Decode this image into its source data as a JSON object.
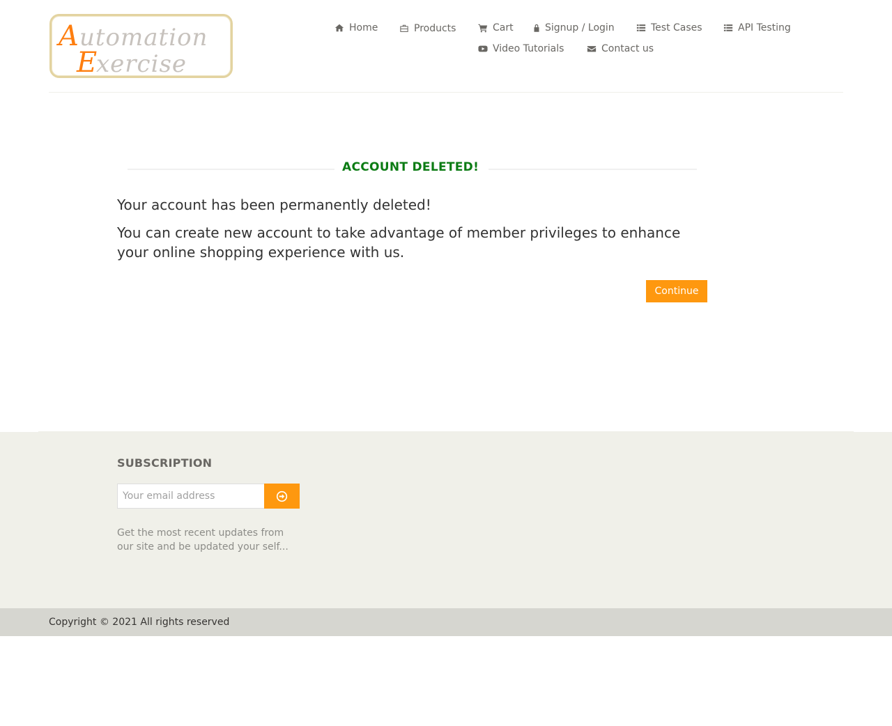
{
  "logo": {
    "line1": "Automation",
    "line2": "Exercise",
    "brand_orange": "#fe7e0f",
    "brand_gray": "#c7c2bd"
  },
  "nav": [
    {
      "label": "Home",
      "icon": "home-icon"
    },
    {
      "label": "Products",
      "icon": "briefcase-icon"
    },
    {
      "label": "Cart",
      "icon": "shopping-cart-icon"
    },
    {
      "label": "Signup / Login",
      "icon": "lock-icon"
    },
    {
      "label": "Test Cases",
      "icon": "list-icon"
    },
    {
      "label": "API Testing",
      "icon": "list-icon"
    },
    {
      "label": "Video Tutorials",
      "icon": "youtube-play-icon"
    },
    {
      "label": "Contact us",
      "icon": "envelope-icon"
    }
  ],
  "main": {
    "title": "ACCOUNT DELETED!",
    "message1": "Your account has been permanently deleted!",
    "message2": "You can create new account to take advantage of member privileges to enhance your online shopping experience with us.",
    "continue_label": "Continue"
  },
  "footer": {
    "subscription_title": "SUBSCRIPTION",
    "email_placeholder": "Your email address",
    "email_value": "",
    "subscribe_icon": "arrow-circle-right-icon",
    "subscription_text": "Get the most recent updates from our site and be updated your self...",
    "copyright": "Copyright © 2021 All rights reserved"
  },
  "colors": {
    "accent": "#fe980f",
    "title_green": "#0c7c14",
    "nav_text": "#696763",
    "footer_bg": "#f0f0e9",
    "footer_bottom_bg": "#d6d6d0"
  }
}
